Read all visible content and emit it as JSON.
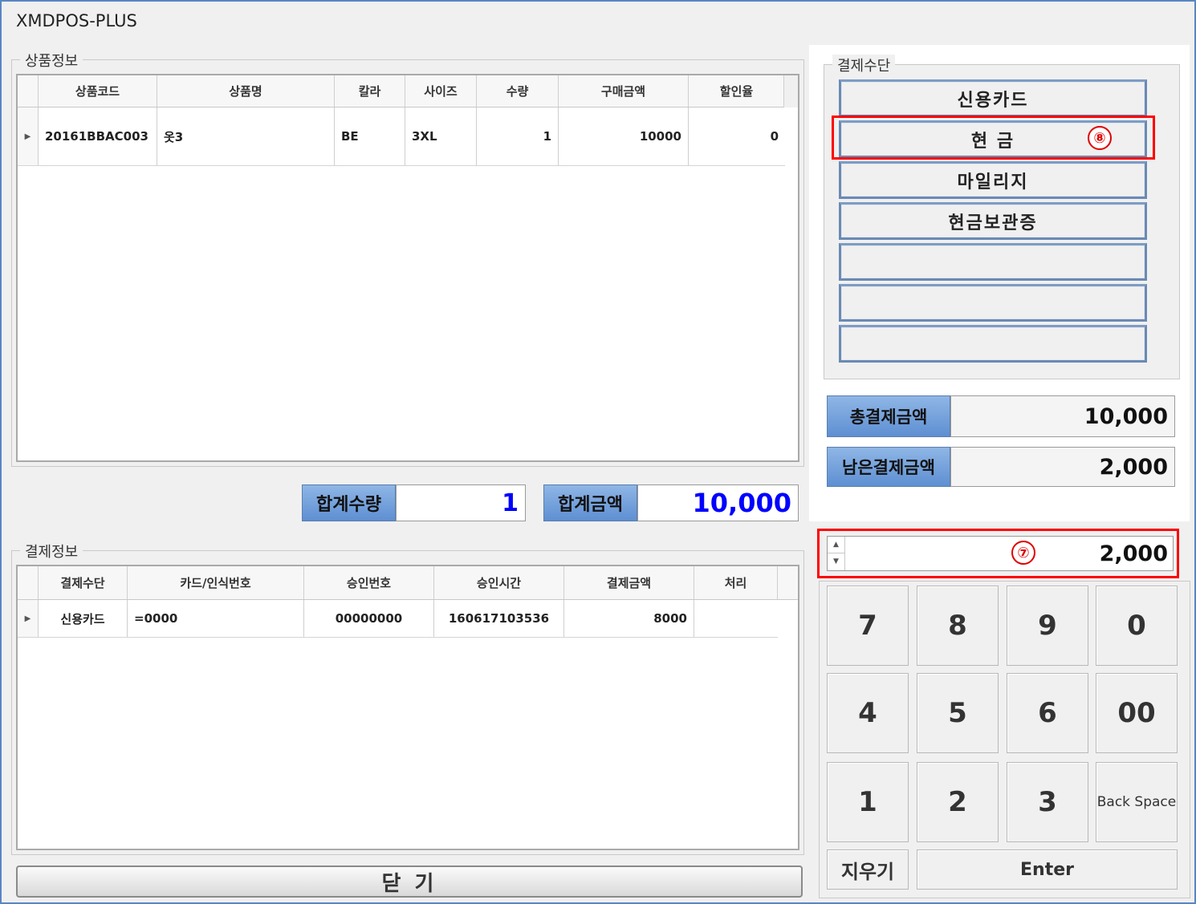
{
  "window": {
    "title": "XMDPOS-PLUS"
  },
  "product": {
    "legend": "상품정보",
    "columns": [
      "상품코드",
      "상품명",
      "칼라",
      "사이즈",
      "수량",
      "구매금액",
      "할인율"
    ],
    "rows": [
      {
        "code": "20161BBAC003",
        "name": "옷3",
        "color": "BE",
        "size": "3XL",
        "qty": "1",
        "amount": "10000",
        "discount": "0"
      }
    ]
  },
  "summary": {
    "qty_label": "합계수량",
    "qty_value": "1",
    "amount_label": "합계금액",
    "amount_value": "10,000",
    "value_color": "#0000ff"
  },
  "payment": {
    "legend": "결제정보",
    "columns": [
      "결제수단",
      "카드/인식번호",
      "승인번호",
      "승인시간",
      "결제금액",
      "처리"
    ],
    "rows": [
      {
        "method": "신용카드",
        "card": "=0000",
        "approval_no": "00000000",
        "approval_time": "160617103536",
        "amount": "8000",
        "status": ""
      }
    ]
  },
  "methods": {
    "legend": "결제수단",
    "buttons": [
      "신용카드",
      "현  금",
      "마일리지",
      "현금보관증",
      "",
      "",
      ""
    ]
  },
  "totals": {
    "total_label": "총결제금액",
    "total_value": "10,000",
    "remaining_label": "남은결제금액",
    "remaining_value": "2,000"
  },
  "input": {
    "value": "2,000"
  },
  "keypad": {
    "keys": [
      "7",
      "8",
      "9",
      "0",
      "4",
      "5",
      "6",
      "00",
      "1",
      "2",
      "3",
      "Back Space"
    ],
    "clear": "지우기",
    "enter": "Enter"
  },
  "close_button": "닫  기",
  "annotations": {
    "badge_input": "⑦",
    "badge_cash": "⑧",
    "color": "#ff0000"
  }
}
